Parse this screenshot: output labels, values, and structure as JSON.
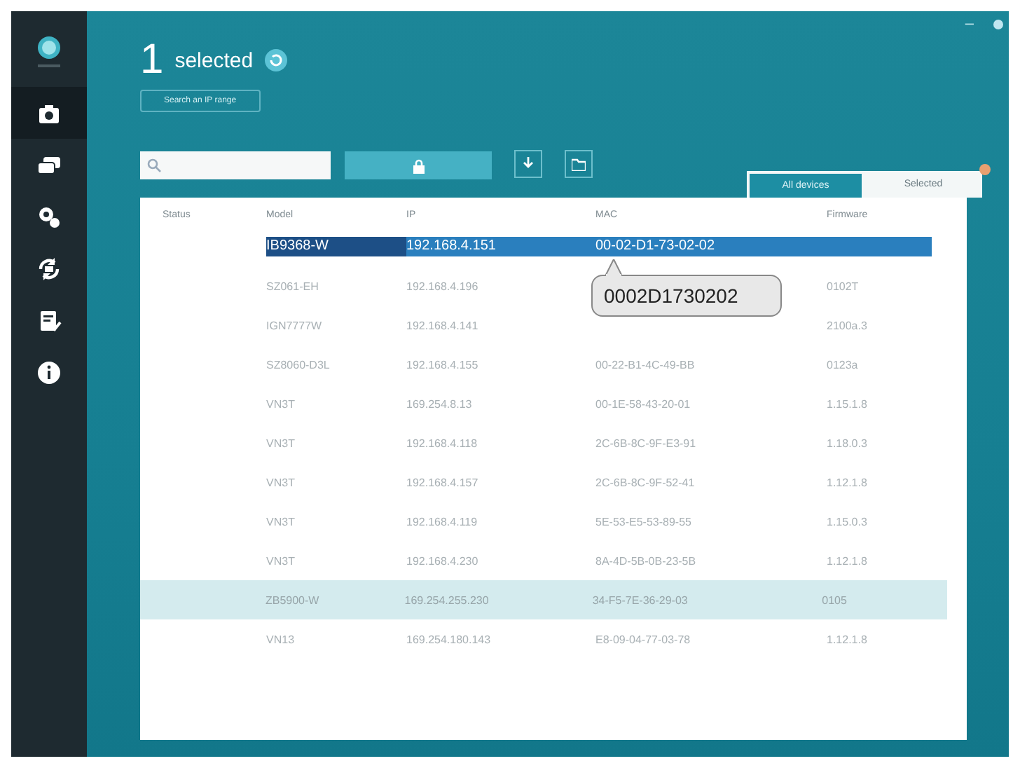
{
  "window": {
    "minimize": "–"
  },
  "sidebar": {
    "items": [
      {
        "kind": "camera",
        "selected": true
      },
      {
        "kind": "cards",
        "selected": false
      },
      {
        "kind": "gears",
        "selected": false
      },
      {
        "kind": "sync",
        "selected": false
      },
      {
        "kind": "report",
        "selected": false
      },
      {
        "kind": "info",
        "selected": false
      }
    ]
  },
  "header": {
    "count": "1",
    "label": "selected",
    "range_button": "Search an IP range"
  },
  "tabs": [
    {
      "label": "All devices",
      "selected": true
    },
    {
      "label": "Selected",
      "selected": false
    }
  ],
  "table": {
    "columns": [
      "Status",
      "Model",
      "IP",
      "MAC",
      "Firmware"
    ],
    "rows": [
      {
        "model": "IB9368-W",
        "ip": "192.168.4.151",
        "mac": "00-02-D1-73-02-02",
        "selected": true,
        "hovered": false
      },
      {
        "model": "SZ061-EH",
        "ip": "192.168.4.196",
        "firmware": "0102T",
        "selected": false,
        "hovered": false
      },
      {
        "model": "IGN7777W",
        "ip": "192.168.4.141",
        "firmware": "2100a.3",
        "selected": false,
        "hovered": false
      },
      {
        "model": "SZ8060-D3L",
        "ip": "192.168.4.155",
        "mac": "00-22-B1-4C-49-BB",
        "firmware": "0123a",
        "selected": false,
        "hovered": false
      },
      {
        "model": "VN3T",
        "ip": "169.254.8.13",
        "mac": "00-1E-58-43-20-01",
        "firmware": "1.15.1.8",
        "selected": false,
        "hovered": false
      },
      {
        "model": "VN3T",
        "ip": "192.168.4.118",
        "mac": "2C-6B-8C-9F-E3-91",
        "firmware": "1.18.0.3",
        "selected": false,
        "hovered": false
      },
      {
        "model": "VN3T",
        "ip": "192.168.4.157",
        "mac": "2C-6B-8C-9F-52-41",
        "firmware": "1.12.1.8",
        "selected": false,
        "hovered": false
      },
      {
        "model": "VN3T",
        "ip": "192.168.4.119",
        "mac": "5E-53-E5-53-89-55",
        "firmware": "1.15.0.3",
        "selected": false,
        "hovered": false
      },
      {
        "model": "VN3T",
        "ip": "192.168.4.230",
        "mac": "8A-4D-5B-0B-23-5B",
        "firmware": "1.12.1.8",
        "selected": false,
        "hovered": false
      },
      {
        "model": "ZB5900-W",
        "ip": "169.254.255.230",
        "mac": "34-F5-7E-36-29-03",
        "firmware": "0105",
        "selected": false,
        "hovered": true
      },
      {
        "model": "VN13",
        "ip": "169.254.180.143",
        "mac": "E8-09-04-77-03-78",
        "firmware": "1.12.1.8",
        "selected": false,
        "hovered": false
      }
    ]
  },
  "tooltip": {
    "text": "0002D1730202"
  }
}
